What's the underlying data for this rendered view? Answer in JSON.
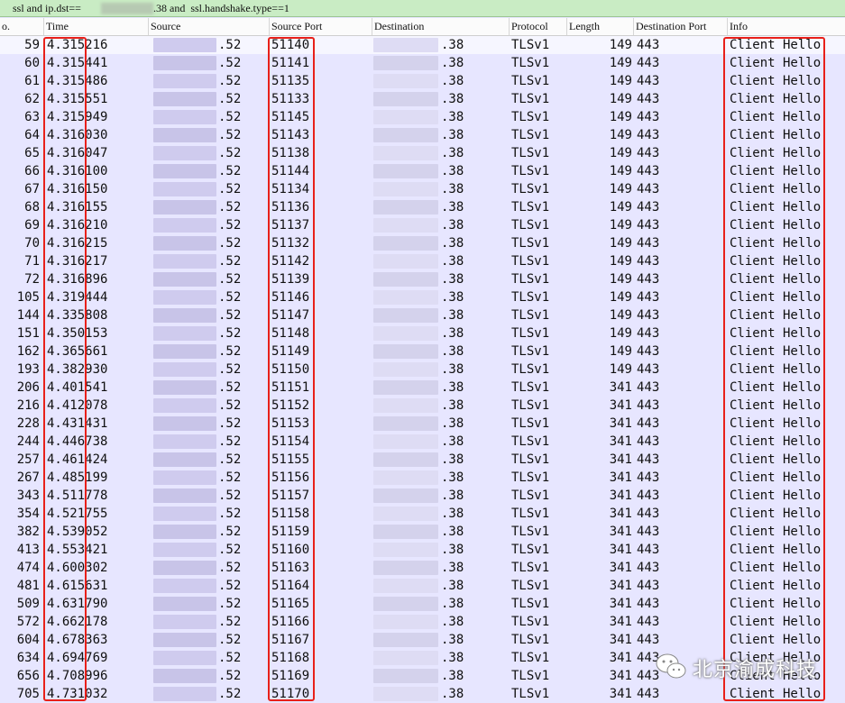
{
  "filter": {
    "part1": "ssl and ip.dst==",
    "part2": ".38 and  ssl.handshake.type==1"
  },
  "columns": {
    "no": "o.",
    "time": "Time",
    "source": "Source",
    "source_port": "Source Port",
    "destination": "Destination",
    "protocol": "Protocol",
    "length": "Length",
    "dest_port": "Destination Port",
    "info": "Info"
  },
  "colors": {
    "background": "#e7e6ff",
    "filter_bg": "#c9ecc4",
    "highlight_border": "#e8201a"
  },
  "rows": [
    {
      "no": "59",
      "time": "4.315216",
      "src": ".52",
      "sport": "51140",
      "dst": ".38",
      "proto": "TLSv1",
      "len": "149",
      "dport": "443",
      "info": "Client Hello"
    },
    {
      "no": "60",
      "time": "4.315441",
      "src": ".52",
      "sport": "51141",
      "dst": ".38",
      "proto": "TLSv1",
      "len": "149",
      "dport": "443",
      "info": "Client Hello"
    },
    {
      "no": "61",
      "time": "4.315486",
      "src": ".52",
      "sport": "51135",
      "dst": ".38",
      "proto": "TLSv1",
      "len": "149",
      "dport": "443",
      "info": "Client Hello"
    },
    {
      "no": "62",
      "time": "4.315551",
      "src": ".52",
      "sport": "51133",
      "dst": ".38",
      "proto": "TLSv1",
      "len": "149",
      "dport": "443",
      "info": "Client Hello"
    },
    {
      "no": "63",
      "time": "4.315949",
      "src": ".52",
      "sport": "51145",
      "dst": ".38",
      "proto": "TLSv1",
      "len": "149",
      "dport": "443",
      "info": "Client Hello"
    },
    {
      "no": "64",
      "time": "4.316030",
      "src": ".52",
      "sport": "51143",
      "dst": ".38",
      "proto": "TLSv1",
      "len": "149",
      "dport": "443",
      "info": "Client Hello"
    },
    {
      "no": "65",
      "time": "4.316047",
      "src": ".52",
      "sport": "51138",
      "dst": ".38",
      "proto": "TLSv1",
      "len": "149",
      "dport": "443",
      "info": "Client Hello"
    },
    {
      "no": "66",
      "time": "4.316100",
      "src": ".52",
      "sport": "51144",
      "dst": ".38",
      "proto": "TLSv1",
      "len": "149",
      "dport": "443",
      "info": "Client Hello"
    },
    {
      "no": "67",
      "time": "4.316150",
      "src": ".52",
      "sport": "51134",
      "dst": ".38",
      "proto": "TLSv1",
      "len": "149",
      "dport": "443",
      "info": "Client Hello"
    },
    {
      "no": "68",
      "time": "4.316155",
      "src": ".52",
      "sport": "51136",
      "dst": ".38",
      "proto": "TLSv1",
      "len": "149",
      "dport": "443",
      "info": "Client Hello"
    },
    {
      "no": "69",
      "time": "4.316210",
      "src": ".52",
      "sport": "51137",
      "dst": ".38",
      "proto": "TLSv1",
      "len": "149",
      "dport": "443",
      "info": "Client Hello"
    },
    {
      "no": "70",
      "time": "4.316215",
      "src": ".52",
      "sport": "51132",
      "dst": ".38",
      "proto": "TLSv1",
      "len": "149",
      "dport": "443",
      "info": "Client Hello"
    },
    {
      "no": "71",
      "time": "4.316217",
      "src": ".52",
      "sport": "51142",
      "dst": ".38",
      "proto": "TLSv1",
      "len": "149",
      "dport": "443",
      "info": "Client Hello"
    },
    {
      "no": "72",
      "time": "4.316896",
      "src": ".52",
      "sport": "51139",
      "dst": ".38",
      "proto": "TLSv1",
      "len": "149",
      "dport": "443",
      "info": "Client Hello"
    },
    {
      "no": "105",
      "time": "4.319444",
      "src": ".52",
      "sport": "51146",
      "dst": ".38",
      "proto": "TLSv1",
      "len": "149",
      "dport": "443",
      "info": "Client Hello"
    },
    {
      "no": "144",
      "time": "4.335808",
      "src": ".52",
      "sport": "51147",
      "dst": ".38",
      "proto": "TLSv1",
      "len": "149",
      "dport": "443",
      "info": "Client Hello"
    },
    {
      "no": "151",
      "time": "4.350153",
      "src": ".52",
      "sport": "51148",
      "dst": ".38",
      "proto": "TLSv1",
      "len": "149",
      "dport": "443",
      "info": "Client Hello"
    },
    {
      "no": "162",
      "time": "4.365661",
      "src": ".52",
      "sport": "51149",
      "dst": ".38",
      "proto": "TLSv1",
      "len": "149",
      "dport": "443",
      "info": "Client Hello"
    },
    {
      "no": "193",
      "time": "4.382930",
      "src": ".52",
      "sport": "51150",
      "dst": ".38",
      "proto": "TLSv1",
      "len": "149",
      "dport": "443",
      "info": "Client Hello"
    },
    {
      "no": "206",
      "time": "4.401541",
      "src": ".52",
      "sport": "51151",
      "dst": ".38",
      "proto": "TLSv1",
      "len": "341",
      "dport": "443",
      "info": "Client Hello"
    },
    {
      "no": "216",
      "time": "4.412078",
      "src": ".52",
      "sport": "51152",
      "dst": ".38",
      "proto": "TLSv1",
      "len": "341",
      "dport": "443",
      "info": "Client Hello"
    },
    {
      "no": "228",
      "time": "4.431431",
      "src": ".52",
      "sport": "51153",
      "dst": ".38",
      "proto": "TLSv1",
      "len": "341",
      "dport": "443",
      "info": "Client Hello"
    },
    {
      "no": "244",
      "time": "4.446738",
      "src": ".52",
      "sport": "51154",
      "dst": ".38",
      "proto": "TLSv1",
      "len": "341",
      "dport": "443",
      "info": "Client Hello"
    },
    {
      "no": "257",
      "time": "4.461424",
      "src": ".52",
      "sport": "51155",
      "dst": ".38",
      "proto": "TLSv1",
      "len": "341",
      "dport": "443",
      "info": "Client Hello"
    },
    {
      "no": "267",
      "time": "4.485199",
      "src": ".52",
      "sport": "51156",
      "dst": ".38",
      "proto": "TLSv1",
      "len": "341",
      "dport": "443",
      "info": "Client Hello"
    },
    {
      "no": "343",
      "time": "4.511778",
      "src": ".52",
      "sport": "51157",
      "dst": ".38",
      "proto": "TLSv1",
      "len": "341",
      "dport": "443",
      "info": "Client Hello"
    },
    {
      "no": "354",
      "time": "4.521755",
      "src": ".52",
      "sport": "51158",
      "dst": ".38",
      "proto": "TLSv1",
      "len": "341",
      "dport": "443",
      "info": "Client Hello"
    },
    {
      "no": "382",
      "time": "4.539052",
      "src": ".52",
      "sport": "51159",
      "dst": ".38",
      "proto": "TLSv1",
      "len": "341",
      "dport": "443",
      "info": "Client Hello"
    },
    {
      "no": "413",
      "time": "4.553421",
      "src": ".52",
      "sport": "51160",
      "dst": ".38",
      "proto": "TLSv1",
      "len": "341",
      "dport": "443",
      "info": "Client Hello"
    },
    {
      "no": "474",
      "time": "4.600302",
      "src": ".52",
      "sport": "51163",
      "dst": ".38",
      "proto": "TLSv1",
      "len": "341",
      "dport": "443",
      "info": "Client Hello"
    },
    {
      "no": "481",
      "time": "4.615631",
      "src": ".52",
      "sport": "51164",
      "dst": ".38",
      "proto": "TLSv1",
      "len": "341",
      "dport": "443",
      "info": "Client Hello"
    },
    {
      "no": "509",
      "time": "4.631790",
      "src": ".52",
      "sport": "51165",
      "dst": ".38",
      "proto": "TLSv1",
      "len": "341",
      "dport": "443",
      "info": "Client Hello"
    },
    {
      "no": "572",
      "time": "4.662178",
      "src": ".52",
      "sport": "51166",
      "dst": ".38",
      "proto": "TLSv1",
      "len": "341",
      "dport": "443",
      "info": "Client Hello"
    },
    {
      "no": "604",
      "time": "4.678363",
      "src": ".52",
      "sport": "51167",
      "dst": ".38",
      "proto": "TLSv1",
      "len": "341",
      "dport": "443",
      "info": "Client Hello"
    },
    {
      "no": "634",
      "time": "4.694769",
      "src": ".52",
      "sport": "51168",
      "dst": ".38",
      "proto": "TLSv1",
      "len": "341",
      "dport": "443",
      "info": "Client Hello"
    },
    {
      "no": "656",
      "time": "4.708996",
      "src": ".52",
      "sport": "51169",
      "dst": ".38",
      "proto": "TLSv1",
      "len": "341",
      "dport": "443",
      "info": "Client Hello"
    },
    {
      "no": "705",
      "time": "4.731032",
      "src": ".52",
      "sport": "51170",
      "dst": ".38",
      "proto": "TLSv1",
      "len": "341",
      "dport": "443",
      "info": "Client Hello"
    }
  ],
  "watermark": {
    "text": "北京渝成科技",
    "icon": "wechat-icon"
  }
}
